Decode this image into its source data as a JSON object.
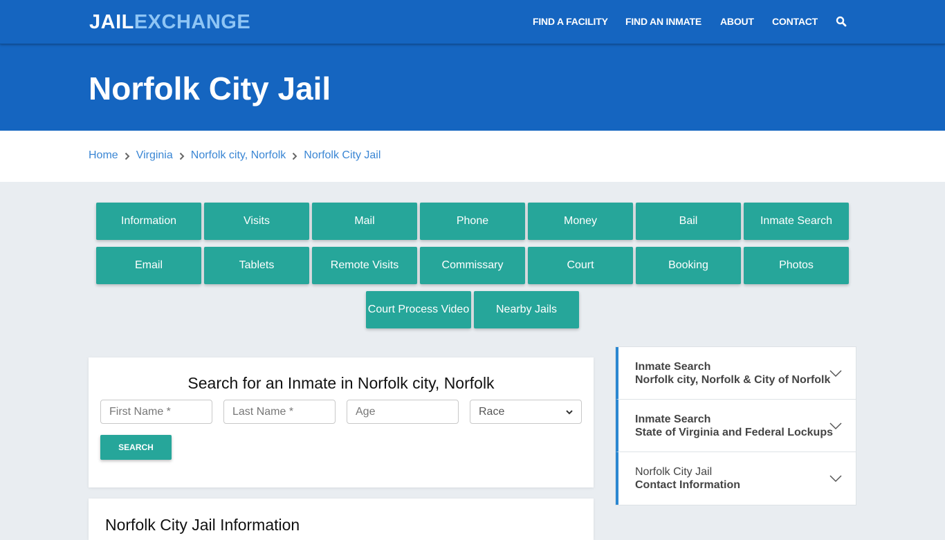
{
  "header": {
    "logo_part1": "JAIL",
    "logo_part2": "EXCHANGE",
    "nav": [
      "FIND A FACILITY",
      "FIND AN INMATE",
      "ABOUT",
      "CONTACT"
    ],
    "search_icon": "search-icon"
  },
  "hero": {
    "title": "Norfolk City Jail"
  },
  "breadcrumb": [
    "Home",
    "Virginia",
    "Norfolk city, Norfolk",
    "Norfolk City Jail"
  ],
  "topic_buttons": [
    "Information",
    "Visits",
    "Mail",
    "Phone",
    "Money",
    "Bail",
    "Inmate Search",
    "Email",
    "Tablets",
    "Remote Visits",
    "Commissary",
    "Court",
    "Booking",
    "Photos",
    "Court Process Video",
    "Nearby Jails"
  ],
  "search_form": {
    "title": "Search for an Inmate in Norfolk city, Norfolk",
    "first_name_placeholder": "First Name *",
    "last_name_placeholder": "Last Name *",
    "age_placeholder": "Age",
    "race_selected": "Race",
    "submit_label": "SEARCH"
  },
  "info_section": {
    "title": "Norfolk City Jail Information"
  },
  "sidebar": [
    {
      "line1": "Inmate Search",
      "line2": "Norfolk city, Norfolk & City of Norfolk"
    },
    {
      "line1": "Inmate Search",
      "line2": "State of Virginia and Federal Lockups"
    },
    {
      "line1": "Norfolk City Jail",
      "line2": "Contact Information"
    }
  ],
  "colors": {
    "brand_blue": "#1565c0",
    "logo_accent": "#8ec5f5",
    "teal_button": "#26a69a",
    "link_blue": "#3a86d4",
    "page_bg": "#e9edf1"
  }
}
